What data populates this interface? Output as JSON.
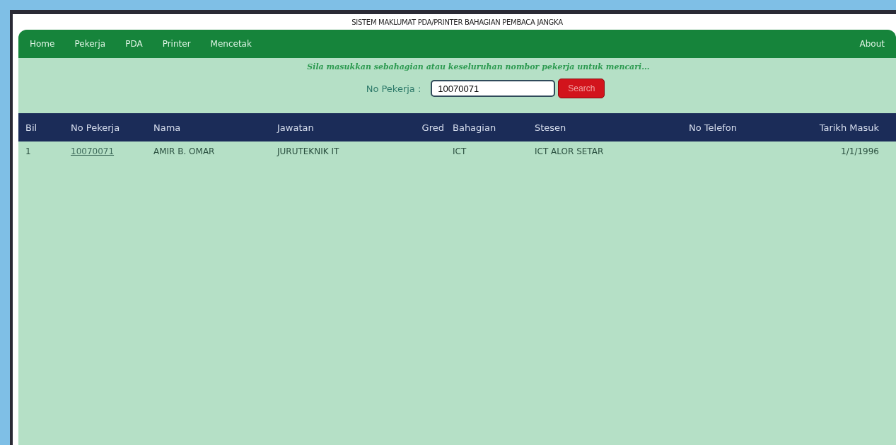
{
  "page_title": "SISTEM MAKLUMAT PDA/PRINTER BAHAGIAN PEMBACA JANGKA",
  "nav": {
    "items": [
      "Home",
      "Pekerja",
      "PDA",
      "Printer",
      "Mencetak"
    ],
    "right_item": "About"
  },
  "search": {
    "hint": "Sila masukkan sebahagian atau keseluruhan nombor pekerja untuk mencari...",
    "label": "No Pekerja :",
    "value": "10070071",
    "button": "Search"
  },
  "table": {
    "columns": [
      "Bil",
      "No Pekerja",
      "Nama",
      "Jawatan",
      "Gred",
      "Bahagian",
      "Stesen",
      "No Telefon",
      "Tarikh Masuk"
    ],
    "rows": [
      {
        "cells": [
          "1",
          "10070071",
          "AMIR B. OMAR",
          "JURUTEKNIK IT",
          "",
          "ICT",
          "ICT ALOR SETAR",
          "",
          "1/1/1996"
        ]
      }
    ]
  }
}
